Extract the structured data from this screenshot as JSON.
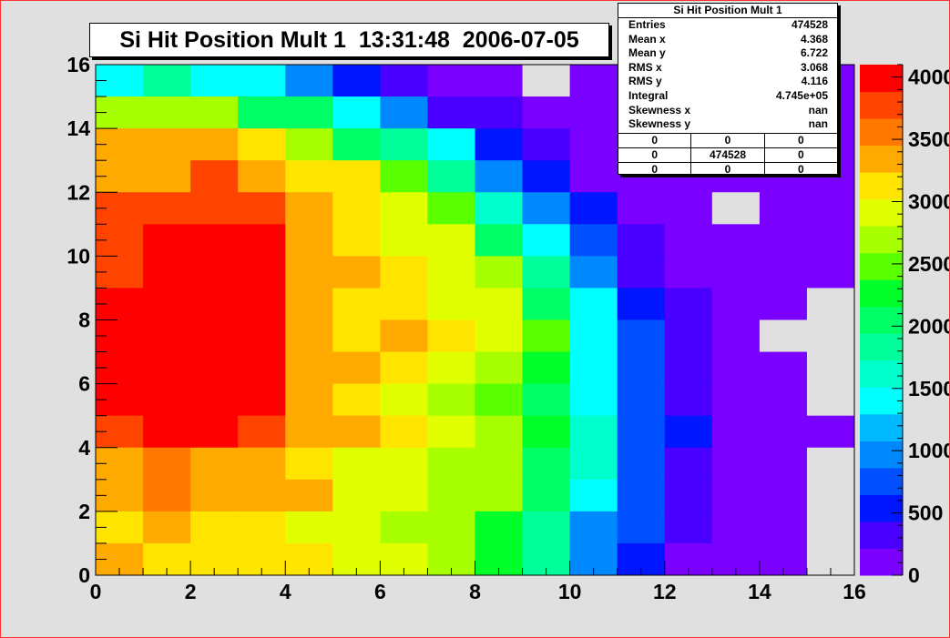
{
  "chart_data": {
    "type": "heatmap",
    "title": "Si Hit Position Mult 1  13:31:48  2006-07-05",
    "xlabel": "",
    "ylabel": "",
    "xlim": [
      0,
      16
    ],
    "ylim": [
      0,
      16
    ],
    "x_ticks": [
      "0",
      "2",
      "4",
      "6",
      "8",
      "10",
      "12",
      "14",
      "16"
    ],
    "y_ticks": [
      "0",
      "2",
      "4",
      "6",
      "8",
      "10",
      "12",
      "14",
      "16"
    ],
    "z_ticks": [
      "0",
      "500",
      "1000",
      "1500",
      "2000",
      "2500",
      "3000",
      "3500",
      "4000"
    ],
    "zlim": [
      0,
      4100
    ],
    "empty_bin_color": "#e0e0e0",
    "palette": [
      "#7a00ff",
      "#4a00ff",
      "#0016ff",
      "#0050ff",
      "#0088ff",
      "#00baff",
      "#00ffff",
      "#00ffcc",
      "#00ff9a",
      "#00ff66",
      "#00ff2a",
      "#5aff00",
      "#a8ff00",
      "#e0ff00",
      "#ffe400",
      "#ffaa00",
      "#ff7800",
      "#ff4400",
      "#ff0000"
    ],
    "rows_top_to_bottom": [
      [
        1500,
        1850,
        1500,
        1350,
        1050,
        600,
        350,
        100,
        100,
        null,
        100,
        100,
        100,
        100,
        100,
        100
      ],
      [
        2650,
        2650,
        2650,
        2050,
        2050,
        1500,
        900,
        400,
        250,
        100,
        100,
        100,
        100,
        100,
        100,
        100
      ],
      [
        3450,
        3450,
        3450,
        3100,
        2750,
        2100,
        1800,
        1300,
        500,
        250,
        100,
        100,
        100,
        100,
        100,
        100
      ],
      [
        3450,
        3450,
        3700,
        3450,
        3100,
        3100,
        2550,
        1850,
        1000,
        500,
        100,
        100,
        100,
        100,
        100,
        100
      ],
      [
        3700,
        3700,
        3700,
        3700,
        3450,
        3100,
        2900,
        2550,
        1650,
        1000,
        500,
        100,
        100,
        null,
        100,
        100
      ],
      [
        3700,
        3900,
        3900,
        3900,
        3450,
        3100,
        2900,
        2900,
        2050,
        1350,
        800,
        300,
        100,
        100,
        100,
        100
      ],
      [
        3700,
        4100,
        3900,
        3900,
        3450,
        3450,
        3100,
        2900,
        2650,
        1750,
        1050,
        400,
        100,
        100,
        100,
        100
      ],
      [
        3900,
        4100,
        3900,
        3900,
        3450,
        3100,
        3100,
        2900,
        2900,
        2050,
        1350,
        550,
        300,
        100,
        100,
        null
      ],
      [
        3900,
        4100,
        3900,
        3900,
        3450,
        3100,
        3450,
        3100,
        2900,
        2450,
        1350,
        800,
        300,
        100,
        null,
        null
      ],
      [
        3900,
        3900,
        3900,
        3900,
        3450,
        3450,
        3100,
        2900,
        2750,
        2250,
        1350,
        800,
        300,
        100,
        100,
        null
      ],
      [
        3900,
        3900,
        3900,
        3900,
        3450,
        3100,
        2900,
        2750,
        2450,
        2050,
        1450,
        800,
        300,
        100,
        100,
        null
      ],
      [
        3700,
        3900,
        3900,
        3700,
        3450,
        3450,
        3100,
        2900,
        2650,
        2250,
        1550,
        800,
        450,
        100,
        100,
        100
      ],
      [
        3450,
        3650,
        3450,
        3450,
        3100,
        2900,
        2900,
        2650,
        2650,
        2050,
        1650,
        800,
        300,
        100,
        100,
        null
      ],
      [
        3450,
        3650,
        3450,
        3450,
        3450,
        2900,
        2900,
        2650,
        2650,
        2050,
        1450,
        800,
        300,
        100,
        100,
        null
      ],
      [
        3100,
        3450,
        3100,
        3100,
        2900,
        2900,
        2750,
        2650,
        2250,
        1850,
        1050,
        800,
        300,
        100,
        100,
        null
      ],
      [
        3450,
        3100,
        3100,
        3100,
        3100,
        2900,
        2900,
        2650,
        2250,
        1850,
        900,
        550,
        100,
        100,
        100,
        null
      ]
    ]
  },
  "stats": {
    "title": "Si Hit Position Mult 1",
    "rows": [
      {
        "label": "Entries",
        "value": "474528"
      },
      {
        "label": "Mean x",
        "value": "4.368"
      },
      {
        "label": "Mean y",
        "value": "6.722"
      },
      {
        "label": "RMS x",
        "value": "3.068"
      },
      {
        "label": "RMS y",
        "value": "4.116"
      },
      {
        "label": "Integral",
        "value": "4.745e+05"
      },
      {
        "label": "Skewness x",
        "value": "nan"
      },
      {
        "label": "Skewness y",
        "value": "nan"
      }
    ],
    "grid": [
      [
        "0",
        "0",
        "0"
      ],
      [
        "0",
        "474528",
        "0"
      ],
      [
        "0",
        "0",
        "0"
      ]
    ]
  }
}
